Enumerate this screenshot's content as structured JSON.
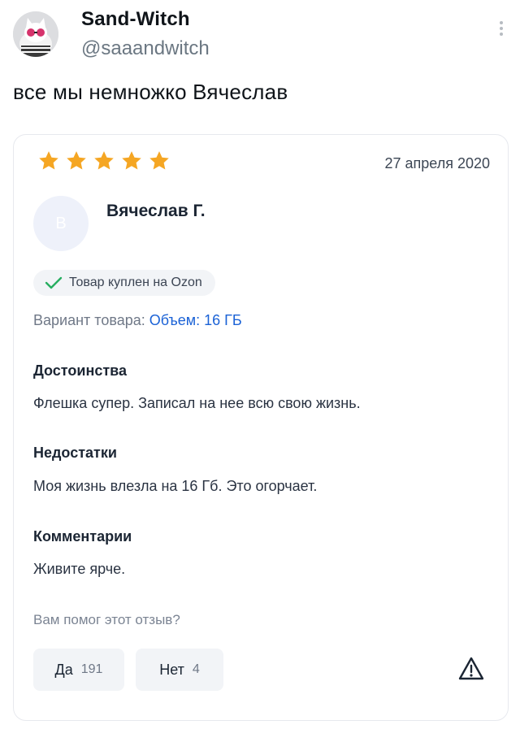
{
  "tweet": {
    "author_name": "Sand-Witch",
    "handle": "@saaandwitch",
    "text": "все мы немножко Вячеслав",
    "avatar_icon": "cat-avatar-icon",
    "more_icon": "more-vertical-icon"
  },
  "review": {
    "rating": 5,
    "max_rating": 5,
    "star_color": "#f5a623",
    "date": "27 апреля 2020",
    "avatar_letter": "В",
    "reviewer_name": "Вячеслав Г.",
    "badge_icon": "check-icon",
    "badge_text": "Товар куплен на Ozon",
    "variant_label": "Вариант товара:",
    "variant_value": "Объем: 16 ГБ",
    "pros_title": "Достоинства",
    "pros_text": "Флешка супер. Записал на нее всю свою жизнь.",
    "cons_title": "Недостатки",
    "cons_text": "Моя жизнь влезла на 16 Гб. Это огорчает.",
    "comment_title": "Комментарии",
    "comment_text": "Живите ярче.",
    "helpful_question": "Вам помог этот отзыв?",
    "yes_label": "Да",
    "yes_count": "191",
    "no_label": "Нет",
    "no_count": "4",
    "report_icon": "warning-triangle-icon"
  }
}
